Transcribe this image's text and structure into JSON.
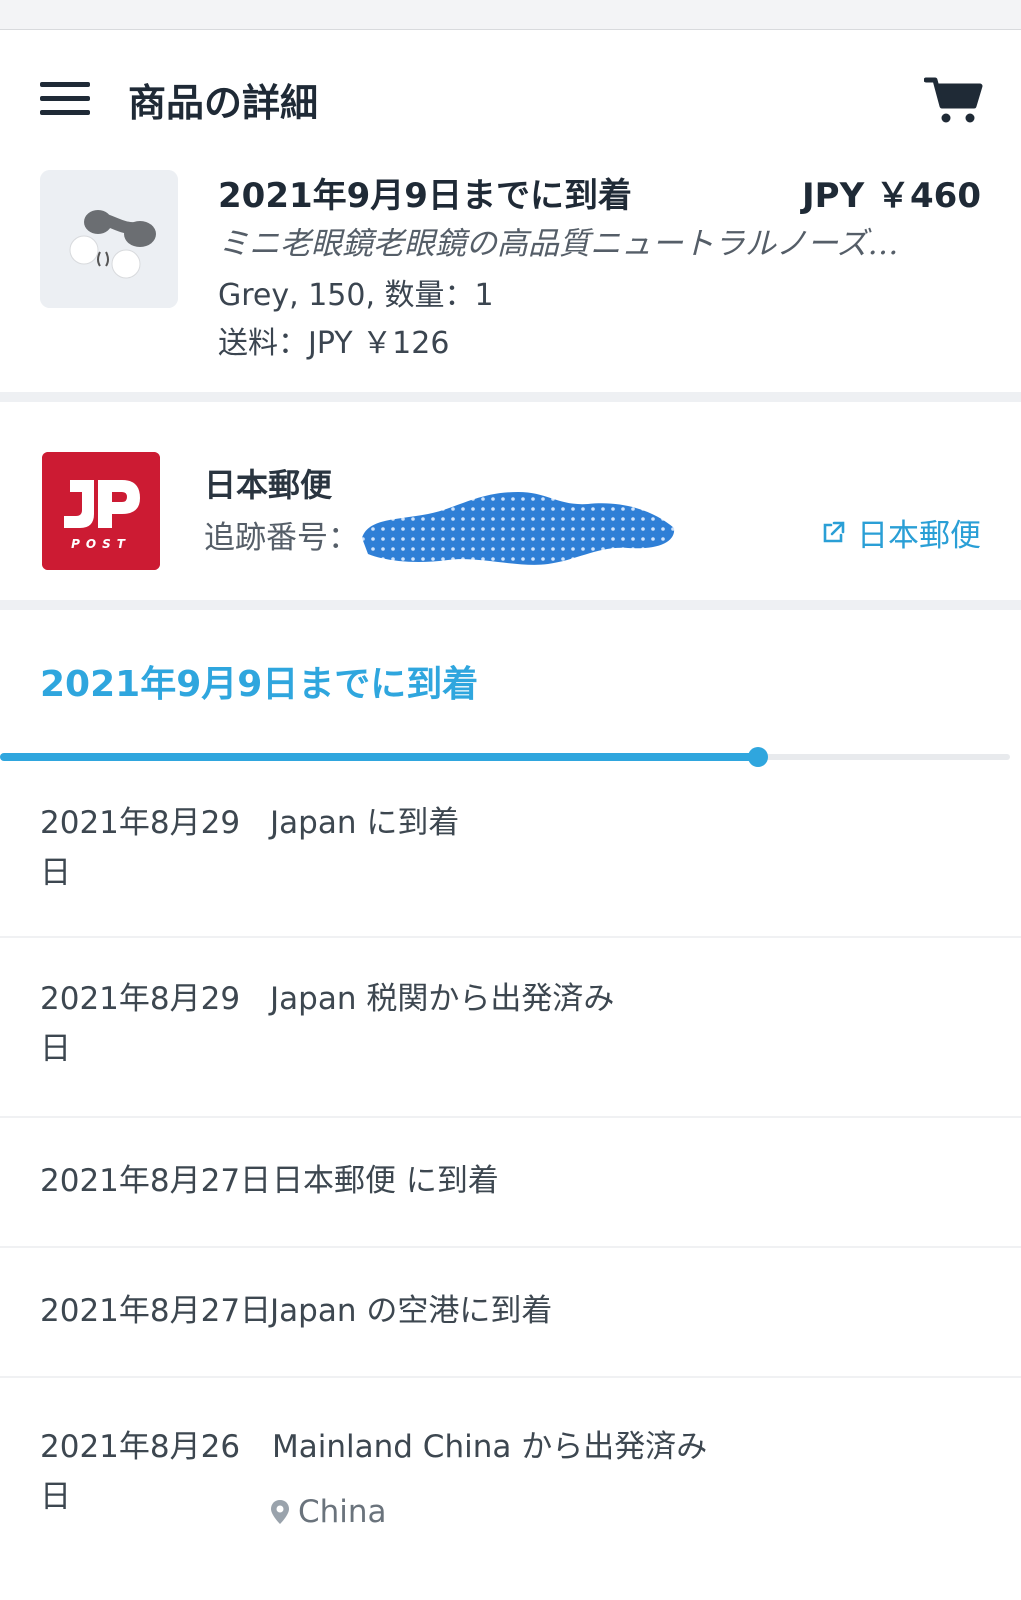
{
  "header": {
    "title": "商品の詳細",
    "menu_icon": "hamburger-menu-icon",
    "cart_icon": "shopping-cart-icon"
  },
  "item": {
    "arrival": "2021年9月9日までに到着",
    "price": "JPY ￥460",
    "name": "ミニ老眼鏡老眼鏡の高品質ニュートラルノーズ…",
    "variant": "Grey, 150, 数量：1",
    "shipping": "送料：JPY ￥126"
  },
  "carrier": {
    "name": "日本郵便",
    "tracking_label": "追跡番号：",
    "link_label": "日本郵便",
    "link_icon": "external-link-icon",
    "logo_text": "JP",
    "logo_subtext": "POST"
  },
  "tracking": {
    "eta": "2021年9月9日までに到着",
    "progress_fraction": 0.75,
    "events": [
      {
        "date": "2021年8月29日",
        "event": "Japan に到着"
      },
      {
        "date": "2021年8月29日",
        "event": "Japan 税関から出発済み"
      },
      {
        "date": "2021年8月27日",
        "event": "日本郵便 に到着"
      },
      {
        "date": "2021年8月27日",
        "event": "Japan の空港に到着"
      },
      {
        "date": "2021年8月26日",
        "event": "Mainland China から出発済み",
        "location": "China"
      }
    ]
  },
  "colors": {
    "accent": "#2fa6de",
    "jp_post_red": "#cc1b33",
    "text_dark": "#1f2a36"
  }
}
